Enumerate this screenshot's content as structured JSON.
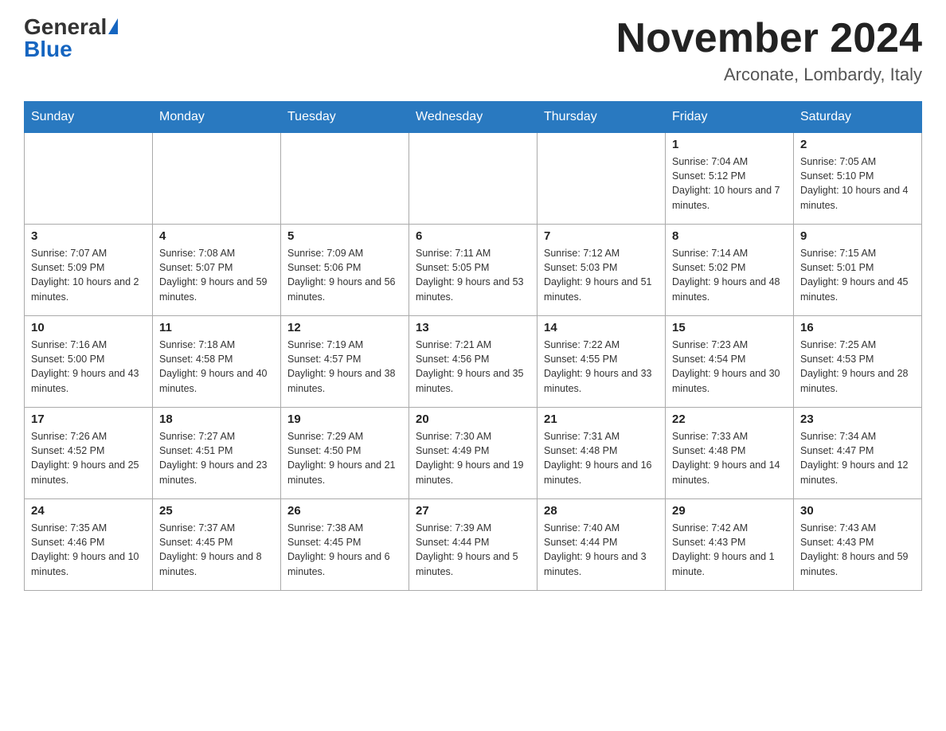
{
  "header": {
    "logo_general": "General",
    "logo_blue": "Blue",
    "month_title": "November 2024",
    "location": "Arconate, Lombardy, Italy"
  },
  "weekdays": [
    "Sunday",
    "Monday",
    "Tuesday",
    "Wednesday",
    "Thursday",
    "Friday",
    "Saturday"
  ],
  "weeks": [
    [
      {
        "day": "",
        "info": ""
      },
      {
        "day": "",
        "info": ""
      },
      {
        "day": "",
        "info": ""
      },
      {
        "day": "",
        "info": ""
      },
      {
        "day": "",
        "info": ""
      },
      {
        "day": "1",
        "info": "Sunrise: 7:04 AM\nSunset: 5:12 PM\nDaylight: 10 hours and 7 minutes."
      },
      {
        "day": "2",
        "info": "Sunrise: 7:05 AM\nSunset: 5:10 PM\nDaylight: 10 hours and 4 minutes."
      }
    ],
    [
      {
        "day": "3",
        "info": "Sunrise: 7:07 AM\nSunset: 5:09 PM\nDaylight: 10 hours and 2 minutes."
      },
      {
        "day": "4",
        "info": "Sunrise: 7:08 AM\nSunset: 5:07 PM\nDaylight: 9 hours and 59 minutes."
      },
      {
        "day": "5",
        "info": "Sunrise: 7:09 AM\nSunset: 5:06 PM\nDaylight: 9 hours and 56 minutes."
      },
      {
        "day": "6",
        "info": "Sunrise: 7:11 AM\nSunset: 5:05 PM\nDaylight: 9 hours and 53 minutes."
      },
      {
        "day": "7",
        "info": "Sunrise: 7:12 AM\nSunset: 5:03 PM\nDaylight: 9 hours and 51 minutes."
      },
      {
        "day": "8",
        "info": "Sunrise: 7:14 AM\nSunset: 5:02 PM\nDaylight: 9 hours and 48 minutes."
      },
      {
        "day": "9",
        "info": "Sunrise: 7:15 AM\nSunset: 5:01 PM\nDaylight: 9 hours and 45 minutes."
      }
    ],
    [
      {
        "day": "10",
        "info": "Sunrise: 7:16 AM\nSunset: 5:00 PM\nDaylight: 9 hours and 43 minutes."
      },
      {
        "day": "11",
        "info": "Sunrise: 7:18 AM\nSunset: 4:58 PM\nDaylight: 9 hours and 40 minutes."
      },
      {
        "day": "12",
        "info": "Sunrise: 7:19 AM\nSunset: 4:57 PM\nDaylight: 9 hours and 38 minutes."
      },
      {
        "day": "13",
        "info": "Sunrise: 7:21 AM\nSunset: 4:56 PM\nDaylight: 9 hours and 35 minutes."
      },
      {
        "day": "14",
        "info": "Sunrise: 7:22 AM\nSunset: 4:55 PM\nDaylight: 9 hours and 33 minutes."
      },
      {
        "day": "15",
        "info": "Sunrise: 7:23 AM\nSunset: 4:54 PM\nDaylight: 9 hours and 30 minutes."
      },
      {
        "day": "16",
        "info": "Sunrise: 7:25 AM\nSunset: 4:53 PM\nDaylight: 9 hours and 28 minutes."
      }
    ],
    [
      {
        "day": "17",
        "info": "Sunrise: 7:26 AM\nSunset: 4:52 PM\nDaylight: 9 hours and 25 minutes."
      },
      {
        "day": "18",
        "info": "Sunrise: 7:27 AM\nSunset: 4:51 PM\nDaylight: 9 hours and 23 minutes."
      },
      {
        "day": "19",
        "info": "Sunrise: 7:29 AM\nSunset: 4:50 PM\nDaylight: 9 hours and 21 minutes."
      },
      {
        "day": "20",
        "info": "Sunrise: 7:30 AM\nSunset: 4:49 PM\nDaylight: 9 hours and 19 minutes."
      },
      {
        "day": "21",
        "info": "Sunrise: 7:31 AM\nSunset: 4:48 PM\nDaylight: 9 hours and 16 minutes."
      },
      {
        "day": "22",
        "info": "Sunrise: 7:33 AM\nSunset: 4:48 PM\nDaylight: 9 hours and 14 minutes."
      },
      {
        "day": "23",
        "info": "Sunrise: 7:34 AM\nSunset: 4:47 PM\nDaylight: 9 hours and 12 minutes."
      }
    ],
    [
      {
        "day": "24",
        "info": "Sunrise: 7:35 AM\nSunset: 4:46 PM\nDaylight: 9 hours and 10 minutes."
      },
      {
        "day": "25",
        "info": "Sunrise: 7:37 AM\nSunset: 4:45 PM\nDaylight: 9 hours and 8 minutes."
      },
      {
        "day": "26",
        "info": "Sunrise: 7:38 AM\nSunset: 4:45 PM\nDaylight: 9 hours and 6 minutes."
      },
      {
        "day": "27",
        "info": "Sunrise: 7:39 AM\nSunset: 4:44 PM\nDaylight: 9 hours and 5 minutes."
      },
      {
        "day": "28",
        "info": "Sunrise: 7:40 AM\nSunset: 4:44 PM\nDaylight: 9 hours and 3 minutes."
      },
      {
        "day": "29",
        "info": "Sunrise: 7:42 AM\nSunset: 4:43 PM\nDaylight: 9 hours and 1 minute."
      },
      {
        "day": "30",
        "info": "Sunrise: 7:43 AM\nSunset: 4:43 PM\nDaylight: 8 hours and 59 minutes."
      }
    ]
  ]
}
